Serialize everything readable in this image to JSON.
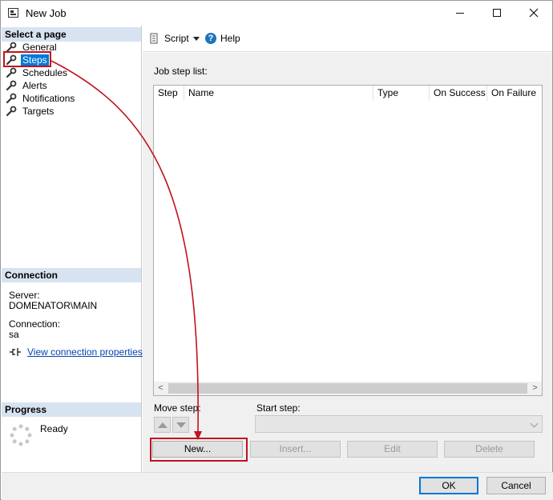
{
  "window": {
    "title": "New Job"
  },
  "left": {
    "select_page_header": "Select a page",
    "pages": [
      "General",
      "Steps",
      "Schedules",
      "Alerts",
      "Notifications",
      "Targets"
    ],
    "selected_page": "Steps",
    "connection_header": "Connection",
    "server_label": "Server:",
    "server_value": "DOMENATOR\\MAIN",
    "connection_label": "Connection:",
    "connection_value": "sa",
    "view_connection_link": "View connection properties",
    "progress_header": "Progress",
    "progress_status": "Ready"
  },
  "toolbar": {
    "script_label": "Script",
    "help_label": "Help"
  },
  "main": {
    "job_step_list_label": "Job step list:",
    "columns": [
      "Step",
      "Name",
      "Type",
      "On Success",
      "On Failure"
    ],
    "rows": [],
    "move_step_label": "Move step:",
    "start_step_label": "Start step:",
    "start_step_value": "",
    "buttons": {
      "new": "New...",
      "insert": "Insert...",
      "edit": "Edit",
      "delete": "Delete"
    }
  },
  "footer": {
    "ok": "OK",
    "cancel": "Cancel"
  },
  "colors": {
    "accent": "#0078d7",
    "annotation": "#c1121f",
    "section_header": "#d7e3f0"
  }
}
